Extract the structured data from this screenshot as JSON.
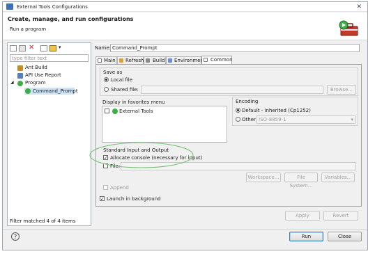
{
  "window": {
    "title": "External Tools Configurations",
    "close_glyph": "✕"
  },
  "header": {
    "title": "Create, manage, and run configurations",
    "subtitle": "Run a program"
  },
  "left": {
    "filter_placeholder": "type filter text",
    "tree": [
      {
        "label": "Ant Build",
        "level": 1,
        "icon": "ant-icon"
      },
      {
        "label": "API Use Report",
        "level": 1,
        "icon": "report-icon"
      },
      {
        "label": "Program",
        "level": 1,
        "icon": "program-icon",
        "expanded": true
      },
      {
        "label": "Command_Prompt",
        "level": 2,
        "icon": "program-launch-icon",
        "selected": true
      }
    ],
    "status": "Filter matched 4 of 4 items"
  },
  "config": {
    "name_label": "Name:",
    "name_value": "Command_Prompt",
    "tabs": [
      "Main",
      "Refresh",
      "Build",
      "Environment",
      "Common"
    ],
    "active_tab": "Common",
    "save_as": {
      "title": "Save as",
      "local": "Local file",
      "shared": "Shared file:",
      "browse": "Browse..."
    },
    "favorites": {
      "title": "Display in favorites menu",
      "item": "External Tools"
    },
    "encoding": {
      "title": "Encoding",
      "default": "Default - inherited (Cp1252)",
      "other": "Other",
      "other_value": "ISO-8859-1"
    },
    "std": {
      "title": "Standard Input and Output",
      "allocate": "Allocate console (necessary for input)",
      "file": "File:",
      "workspace": "Workspace...",
      "filesystem": "File System...",
      "variables": "Variables...",
      "append": "Append"
    },
    "launch_bg": "Launch in background",
    "apply": "Apply",
    "revert": "Revert"
  },
  "footer": {
    "help": "?",
    "run": "Run",
    "close": "Close"
  },
  "colors": {
    "highlight_ellipse": "#6fbf6f",
    "selection": "#cce4f7"
  }
}
